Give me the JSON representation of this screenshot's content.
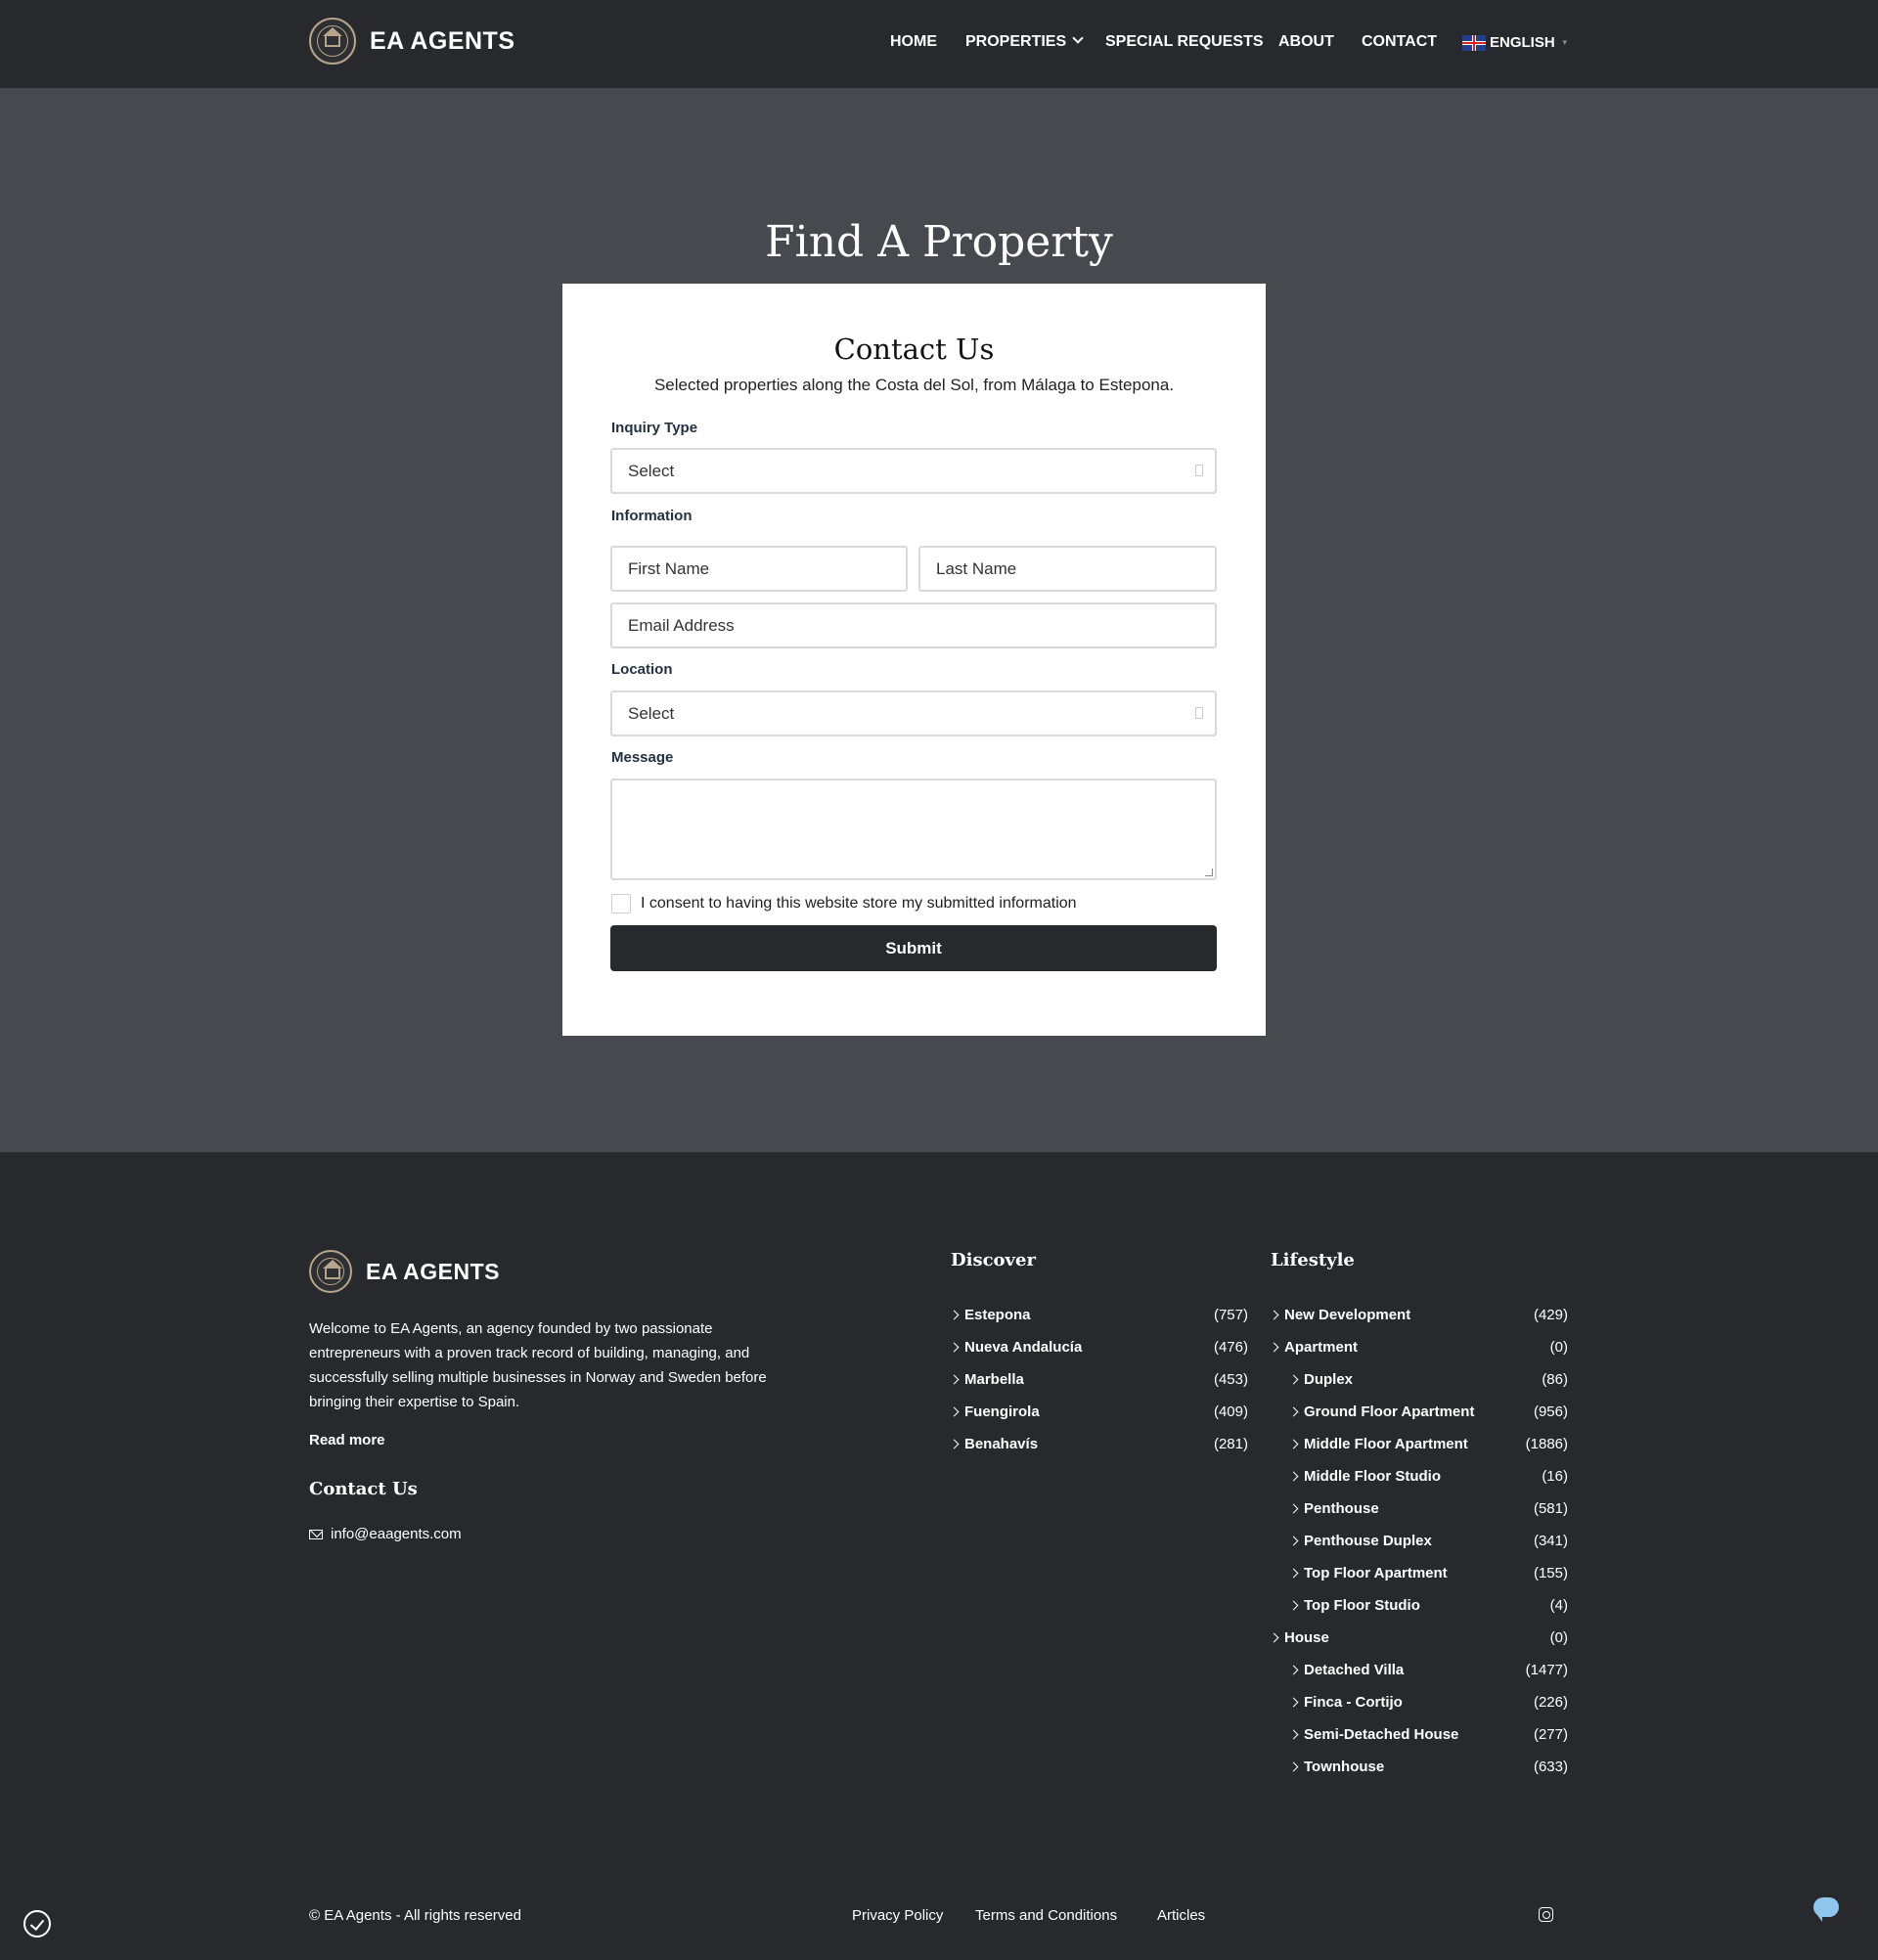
{
  "header": {
    "brand": "EA AGENTS",
    "nav": {
      "home": "HOME",
      "properties": "PROPERTIES",
      "special_requests": "SPECIAL REQUESTS",
      "about": "ABOUT",
      "contact": "CONTACT"
    },
    "language": "ENGLISH"
  },
  "hero": {
    "title": "Find A Property"
  },
  "form": {
    "title": "Contact Us",
    "subtitle": "Selected properties along the Costa del Sol, from Málaga to Estepona.",
    "inquiry_label": "Inquiry Type",
    "inquiry_value": "Select",
    "information_label": "Information",
    "first_name_placeholder": "First Name",
    "last_name_placeholder": "Last Name",
    "email_placeholder": "Email Address",
    "location_label": "Location",
    "location_value": "Select",
    "message_label": "Message",
    "consent_text": "I consent to having this website store my submitted information",
    "submit_label": "Submit"
  },
  "footer": {
    "brand": "EA AGENTS",
    "about": "Welcome to EA Agents, an agency founded by two passionate entrepreneurs with a proven track record of building, managing, and successfully selling multiple businesses in Norway and Sweden before bringing their expertise to Spain.",
    "read_more": "Read more",
    "contact_heading": "Contact Us",
    "email": "info@eaagents.com",
    "discover": {
      "heading": "Discover",
      "items": [
        {
          "name": "Estepona",
          "count": "(757)"
        },
        {
          "name": "Nueva Andalucía",
          "count": "(476)"
        },
        {
          "name": "Marbella",
          "count": "(453)"
        },
        {
          "name": "Fuengirola",
          "count": "(409)"
        },
        {
          "name": "Benahavís",
          "count": "(281)"
        }
      ]
    },
    "lifestyle": {
      "heading": "Lifestyle",
      "items": [
        {
          "name": "New Development",
          "count": "(429)"
        },
        {
          "name": "Apartment",
          "count": "(0)"
        },
        {
          "name": "Duplex",
          "count": "(86)"
        },
        {
          "name": "Ground Floor Apartment",
          "count": "(956)"
        },
        {
          "name": "Middle Floor Apartment",
          "count": "(1886)"
        },
        {
          "name": "Middle Floor Studio",
          "count": "(16)"
        },
        {
          "name": "Penthouse",
          "count": "(581)"
        },
        {
          "name": "Penthouse Duplex",
          "count": "(341)"
        },
        {
          "name": "Top Floor Apartment",
          "count": "(155)"
        },
        {
          "name": "Top Floor Studio",
          "count": "(4)"
        },
        {
          "name": "House",
          "count": "(0)"
        },
        {
          "name": "Detached Villa",
          "count": "(1477)"
        },
        {
          "name": "Finca - Cortijo",
          "count": "(226)"
        },
        {
          "name": "Semi-Detached House",
          "count": "(277)"
        },
        {
          "name": "Townhouse",
          "count": "(633)"
        }
      ]
    },
    "copyright": "© EA Agents - All rights reserved",
    "links": {
      "privacy": "Privacy Policy",
      "terms": "Terms and Conditions",
      "articles": "Articles"
    }
  },
  "icons": {
    "social": "instagram-icon",
    "cookie": "cookie-consent-icon",
    "chat": "chat-bubble-icon"
  }
}
